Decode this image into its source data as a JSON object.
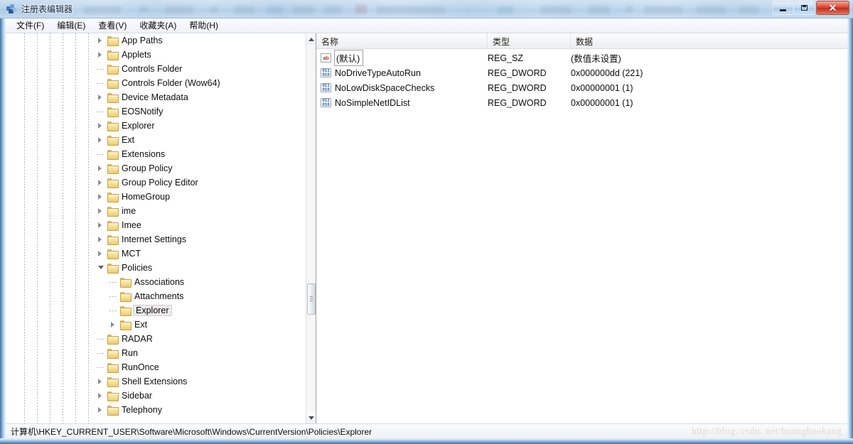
{
  "window": {
    "title": "注册表编辑器",
    "app_icon": "registry-editor-icon",
    "buttons": {
      "minimize": "最小化",
      "maximize": "最大化",
      "close": "关闭",
      "close_glyph": "✕"
    }
  },
  "menubar": {
    "items": [
      {
        "label": "文件(F)",
        "name": "menu-file"
      },
      {
        "label": "编辑(E)",
        "name": "menu-edit"
      },
      {
        "label": "查看(V)",
        "name": "menu-view"
      },
      {
        "label": "收藏夹(A)",
        "name": "menu-favorites"
      },
      {
        "label": "帮助(H)",
        "name": "menu-help"
      }
    ]
  },
  "tree": {
    "nodes": [
      {
        "label": "App Paths",
        "indent": 0,
        "expander": "closed",
        "selected": false
      },
      {
        "label": "Applets",
        "indent": 0,
        "expander": "closed",
        "selected": false
      },
      {
        "label": "Controls Folder",
        "indent": 0,
        "expander": "none",
        "selected": false
      },
      {
        "label": "Controls Folder (Wow64)",
        "indent": 0,
        "expander": "none",
        "selected": false
      },
      {
        "label": "Device Metadata",
        "indent": 0,
        "expander": "closed",
        "selected": false
      },
      {
        "label": "EOSNotify",
        "indent": 0,
        "expander": "none",
        "selected": false
      },
      {
        "label": "Explorer",
        "indent": 0,
        "expander": "closed",
        "selected": false
      },
      {
        "label": "Ext",
        "indent": 0,
        "expander": "closed",
        "selected": false
      },
      {
        "label": "Extensions",
        "indent": 0,
        "expander": "none",
        "selected": false
      },
      {
        "label": "Group Policy",
        "indent": 0,
        "expander": "closed",
        "selected": false
      },
      {
        "label": "Group Policy Editor",
        "indent": 0,
        "expander": "closed",
        "selected": false
      },
      {
        "label": "HomeGroup",
        "indent": 0,
        "expander": "closed",
        "selected": false
      },
      {
        "label": "ime",
        "indent": 0,
        "expander": "closed",
        "selected": false
      },
      {
        "label": "Imee",
        "indent": 0,
        "expander": "closed",
        "selected": false
      },
      {
        "label": "Internet Settings",
        "indent": 0,
        "expander": "closed",
        "selected": false
      },
      {
        "label": "MCT",
        "indent": 0,
        "expander": "closed",
        "selected": false
      },
      {
        "label": "Policies",
        "indent": 0,
        "expander": "open",
        "selected": false
      },
      {
        "label": "Associations",
        "indent": 1,
        "expander": "none",
        "selected": false
      },
      {
        "label": "Attachments",
        "indent": 1,
        "expander": "none",
        "selected": false
      },
      {
        "label": "Explorer",
        "indent": 1,
        "expander": "none",
        "selected": true
      },
      {
        "label": "Ext",
        "indent": 1,
        "expander": "closed",
        "selected": false
      },
      {
        "label": "RADAR",
        "indent": 0,
        "expander": "none",
        "selected": false
      },
      {
        "label": "Run",
        "indent": 0,
        "expander": "none",
        "selected": false
      },
      {
        "label": "RunOnce",
        "indent": 0,
        "expander": "none",
        "selected": false
      },
      {
        "label": "Shell Extensions",
        "indent": 0,
        "expander": "closed",
        "selected": false
      },
      {
        "label": "Sidebar",
        "indent": 0,
        "expander": "closed",
        "selected": false
      },
      {
        "label": "Telephony",
        "indent": 0,
        "expander": "closed",
        "selected": false
      }
    ],
    "scrollbar": {
      "up_arrow": "▲",
      "down_arrow": "▼"
    }
  },
  "list": {
    "columns": [
      {
        "label": "名称",
        "name": "column-name"
      },
      {
        "label": "类型",
        "name": "column-type"
      },
      {
        "label": "数据",
        "name": "column-data"
      }
    ],
    "rows": [
      {
        "name": "(默认)",
        "type": "REG_SZ",
        "data": "(数值未设置)",
        "icon": "string-value-icon",
        "focused": true
      },
      {
        "name": "NoDriveTypeAutoRun",
        "type": "REG_DWORD",
        "data": "0x000000dd (221)",
        "icon": "dword-value-icon",
        "focused": false
      },
      {
        "name": "NoLowDiskSpaceChecks",
        "type": "REG_DWORD",
        "data": "0x00000001 (1)",
        "icon": "dword-value-icon",
        "focused": false
      },
      {
        "name": "NoSimpleNetIDList",
        "type": "REG_DWORD",
        "data": "0x00000001 (1)",
        "icon": "dword-value-icon",
        "focused": false
      }
    ],
    "icon_glyphs": {
      "sz": "ab",
      "dword_top": "011",
      "dword_bottom": "010"
    }
  },
  "statusbar": {
    "path": "计算机\\HKEY_CURRENT_USER\\Software\\Microsoft\\Windows\\CurrentVersion\\Policies\\Explorer",
    "watermark": "http://blog. csdn. net/huangbaokang"
  },
  "colors": {
    "frame": "#6f9cc6",
    "close_button": "#d9412c",
    "folder": "#eecb6b",
    "selection": "#eceaea",
    "dword_icon": "#1f5fa8",
    "sz_icon": "#c0392b"
  }
}
